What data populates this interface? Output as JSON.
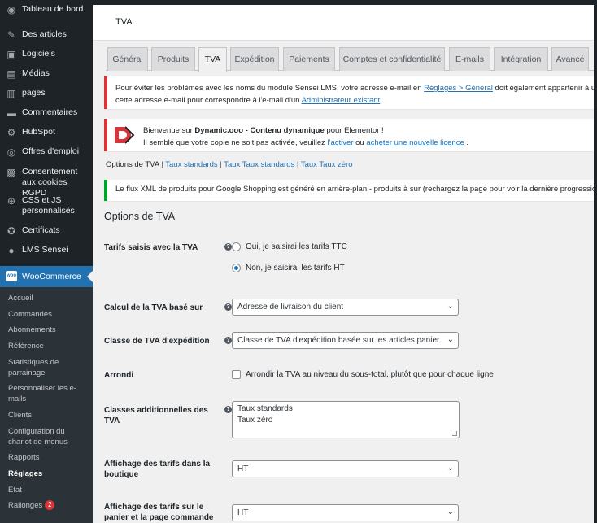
{
  "sidebar": {
    "items": [
      {
        "label": "Tableau de bord",
        "icon": "dashboard-icon",
        "glyph": "◉"
      },
      {
        "label": "Des articles",
        "icon": "pin-icon",
        "glyph": "✎"
      },
      {
        "label": "Logiciels",
        "icon": "monitor-icon",
        "glyph": "▣"
      },
      {
        "label": "Médias",
        "icon": "media-icon",
        "glyph": "▤"
      },
      {
        "label": "pages",
        "icon": "pages-icon",
        "glyph": "▥"
      },
      {
        "label": "Commentaires",
        "icon": "comment-icon",
        "glyph": "▬"
      },
      {
        "label": "HubSpot",
        "icon": "hubspot-icon",
        "glyph": "⚙"
      },
      {
        "label": "Offres d'emploi",
        "icon": "jobs-icon",
        "glyph": "◎"
      },
      {
        "label": "Consentement aux cookies RGPD",
        "icon": "lock-icon",
        "glyph": "▩"
      },
      {
        "label": "CSS et JS personnalisés",
        "icon": "plus-circle-icon",
        "glyph": "⊕"
      },
      {
        "label": "Certificats",
        "icon": "award-icon",
        "glyph": "✪"
      },
      {
        "label": "LMS Sensei",
        "icon": "sensei-icon",
        "glyph": "●"
      }
    ],
    "woocommerce": {
      "label": "WooCommerce",
      "logo": "woo"
    },
    "submenu": [
      {
        "label": "Accueil"
      },
      {
        "label": "Commandes"
      },
      {
        "label": "Abonnements"
      },
      {
        "label": "Référence"
      },
      {
        "label": "Statistiques de parrainage"
      },
      {
        "label": "Personnaliser les e-mails"
      },
      {
        "label": "Clients"
      },
      {
        "label": "Configuration du chariot de menus"
      },
      {
        "label": "Rapports"
      },
      {
        "label": "Réglages"
      },
      {
        "label": "État"
      },
      {
        "label": "Rallonges",
        "badge": "2"
      }
    ]
  },
  "header": {
    "title": "TVA"
  },
  "tabs": [
    "Général",
    "Produits",
    "TVA",
    "Expédition",
    "Paiements",
    "Comptes et confidentialité",
    "E-mails",
    "Intégration",
    "Avancé"
  ],
  "active_tab": "TVA",
  "notice1": {
    "line1_pre": "Pour éviter les problèmes avec les noms du module Sensei LMS, votre adresse e-mail en ",
    "line1_link": "Réglages > Général",
    "line1_post": " doit également appartenir à un uti",
    "line2_pre": "cette adresse e-mail pour correspondre à l'e-mail d'un ",
    "line2_link": "Administrateur existant",
    "line2_post": "."
  },
  "notice2": {
    "logo_letter": "D",
    "line1_pre": "Bienvenue sur ",
    "line1_bold": "Dynamic.ooo - Contenu dynamique",
    "line1_post": " pour Elementor !",
    "line2_pre": "Il semble que votre copie ne soit pas activée, veuillez ",
    "line2_link1": "l'activer",
    "line2_mid": " ou ",
    "line2_link2": "acheter une nouvelle licence",
    "line2_post": " ."
  },
  "subnav": {
    "current": "Options de TVA",
    "links": [
      "Taux standards",
      "Taux Taux standards",
      "Taux Taux zéro"
    ]
  },
  "notice3": {
    "text": "Le flux XML de produits pour Google Shopping est généré en arrière-plan - produits à sur (rechargez la page pour voir la dernière progression)."
  },
  "section_title": "Options de TVA",
  "fields": {
    "tarifs_label": "Tarifs saisis avec la TVA",
    "tarifs_opt1": "Oui, je saisirai les tarifs TTC",
    "tarifs_opt2": "Non, je saisirai les tarifs HT",
    "calcul_label": "Calcul de la TVA basé sur",
    "calcul_value": "Adresse de livraison du client",
    "classe_label": "Classe de TVA d'expédition",
    "classe_value": "Classe de TVA d'expédition basée sur les articles panier",
    "arrondi_label": "Arrondi",
    "arrondi_text": "Arrondir la TVA au niveau du sous-total, plutôt que pour chaque ligne",
    "classes_add_label": "Classes additionnelles des TVA",
    "classes_add_line1": "Taux standards",
    "classes_add_line2": "Taux zéro",
    "affichage_boutique_label": "Affichage des tarifs dans la boutique",
    "affichage_boutique_value": "HT",
    "affichage_panier_label": "Affichage des tarifs sur le panier et la page commande",
    "affichage_panier_value": "HT"
  },
  "colors": {
    "admin_bar": "#1d2327",
    "accent": "#2271b1",
    "error": "#d63638",
    "success": "#00a32a"
  }
}
